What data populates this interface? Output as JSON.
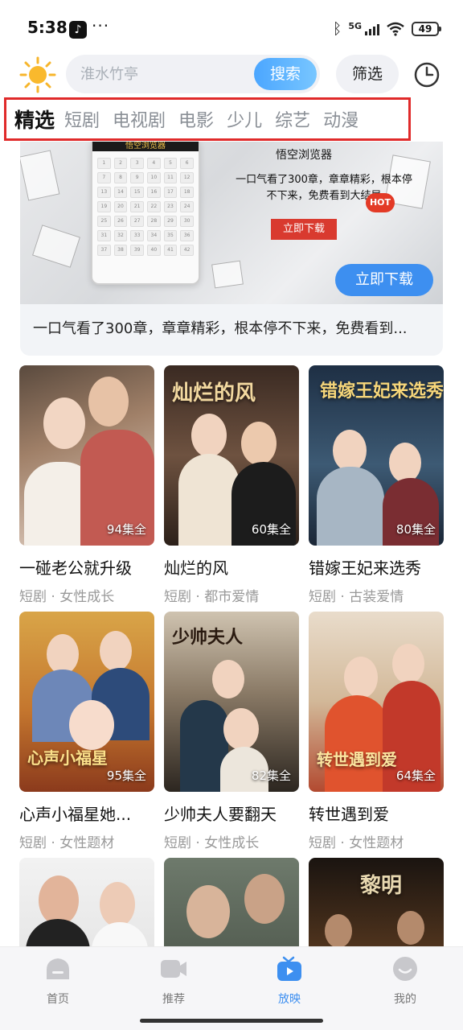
{
  "status_bar": {
    "time": "5:38",
    "app_icon": "tiktok-icon",
    "dots": "···",
    "network": "5G",
    "battery": "49"
  },
  "search": {
    "placeholder": "淮水竹亭",
    "button_label": "搜索",
    "filter_label": "筛选"
  },
  "tabs": [
    {
      "label": "精选",
      "active": true
    },
    {
      "label": "短剧",
      "active": false
    },
    {
      "label": "电视剧",
      "active": false
    },
    {
      "label": "电影",
      "active": false
    },
    {
      "label": "少儿",
      "active": false
    },
    {
      "label": "综艺",
      "active": false
    },
    {
      "label": "动漫",
      "active": false
    }
  ],
  "ad": {
    "phone_header": "悟空浏览器",
    "title": "悟空浏览器",
    "subtitle": "一口气看了300章，章章精彩，根本停不下来，免费看到大结局",
    "hot": "HOT",
    "small_download": "立即下载",
    "download_button": "立即下载",
    "caption": "一口气看了300章，章章精彩，根本停不下来，免费看到..."
  },
  "dramas": [
    {
      "title": "一碰老公就升级",
      "episodes": "94集全",
      "tags": "短剧 · 女性成长",
      "poster_title": ""
    },
    {
      "title": "灿烂的风",
      "episodes": "60集全",
      "tags": "短剧 · 都市爱情",
      "poster_title": "灿烂的风"
    },
    {
      "title": "错嫁王妃来选秀",
      "episodes": "80集全",
      "tags": "短剧 · 古装爱情",
      "poster_title": "错嫁王妃来选秀"
    },
    {
      "title": "心声小福星她...",
      "episodes": "95集全",
      "tags": "短剧 · 女性题材",
      "poster_title": "心声小福星"
    },
    {
      "title": "少帅夫人要翻天",
      "episodes": "82集全",
      "tags": "短剧 · 女性成长",
      "poster_title": "少帅夫人"
    },
    {
      "title": "转世遇到爱",
      "episodes": "64集全",
      "tags": "短剧 · 女性题材",
      "poster_title": "转世遇到爱"
    },
    {
      "title": "",
      "episodes": "",
      "tags": "",
      "poster_title": ""
    },
    {
      "title": "",
      "episodes": "",
      "tags": "",
      "poster_title": ""
    },
    {
      "title": "",
      "episodes": "",
      "tags": "",
      "poster_title": "黎明"
    }
  ],
  "bottom_nav": [
    {
      "label": "首页",
      "icon": "home-icon",
      "active": false
    },
    {
      "label": "推荐",
      "icon": "video-camera-icon",
      "active": false
    },
    {
      "label": "放映",
      "icon": "tv-play-icon",
      "active": true
    },
    {
      "label": "我的",
      "icon": "profile-icon",
      "active": false
    }
  ],
  "colors": {
    "accent": "#3d8ff0",
    "highlight_border": "#e02a2a",
    "muted_text": "#999999"
  }
}
